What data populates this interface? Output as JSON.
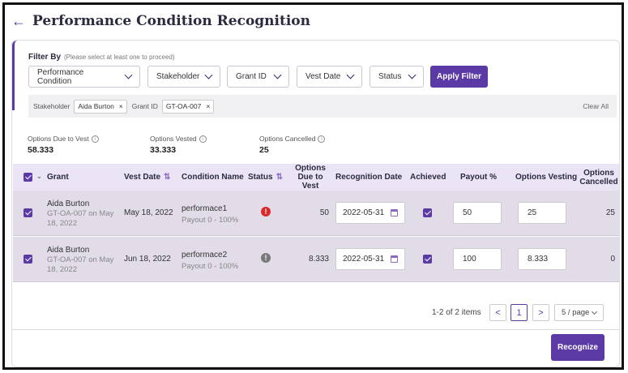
{
  "page": {
    "title": "Performance Condition Recognition"
  },
  "filter": {
    "label": "Filter By",
    "hint": "(Please select at least one to proceed)",
    "dropdowns": [
      "Performance Condition",
      "Stakeholder",
      "Grant ID",
      "Vest Date",
      "Status"
    ],
    "apply_label": "Apply Filter",
    "chips": [
      {
        "key": "Stakeholder",
        "value": "Aida Burton"
      },
      {
        "key": "Grant ID",
        "value": "GT-OA-007"
      }
    ],
    "clear_all": "Clear All"
  },
  "summary": {
    "due": {
      "label": "Options Due to Vest",
      "value": "58.333"
    },
    "vested": {
      "label": "Options Vested",
      "value": "33.333"
    },
    "cancelled": {
      "label": "Options Cancelled",
      "value": "25"
    }
  },
  "table": {
    "headers": {
      "grant": "Grant",
      "vest_date": "Vest Date",
      "condition": "Condition Name",
      "status": "Status",
      "due": "Options Due to Vest",
      "recognition": "Recognition Date",
      "achieved": "Achieved",
      "payout": "Payout %",
      "vesting": "Options Vesting",
      "cancelled": "Options Cancelled"
    },
    "rows": [
      {
        "name": "Aida Burton",
        "grant_sub": "GT-OA-007 on May 18, 2022",
        "vest_date": "May 18, 2022",
        "condition": "performace1",
        "payout_range": "Payout 0 - 100%",
        "status_icon": "!",
        "status_color": "#d92b2b",
        "due": "50",
        "recognition_date": "2022-05-31",
        "payout": "50",
        "vesting": "25",
        "cancelled": "25"
      },
      {
        "name": "Aida Burton",
        "grant_sub": "GT-OA-007 on May 18, 2022",
        "vest_date": "Jun 18, 2022",
        "condition": "performace2",
        "payout_range": "Payout 0 - 100%",
        "status_icon": "!",
        "status_color": "#7a7a7a",
        "due": "8.333",
        "recognition_date": "2022-05-31",
        "payout": "100",
        "vesting": "8.333",
        "cancelled": "0"
      }
    ]
  },
  "pagination": {
    "summary": "1-2 of 2 items",
    "prev": "<",
    "current": "1",
    "next": ">",
    "page_size": "5 / page"
  },
  "actions": {
    "recognize": "Recognize"
  },
  "colors": {
    "accent": "#5b3aa5",
    "header_bg": "#ebe4f5",
    "row_bg": "#e2dbe8",
    "error": "#d92b2b"
  },
  "icons": {
    "back": "back-arrow-icon",
    "calendar": "calendar-icon",
    "info": "info-icon",
    "sort": "sort-icon",
    "chevron": "chevron-down-icon",
    "close": "close-icon"
  }
}
